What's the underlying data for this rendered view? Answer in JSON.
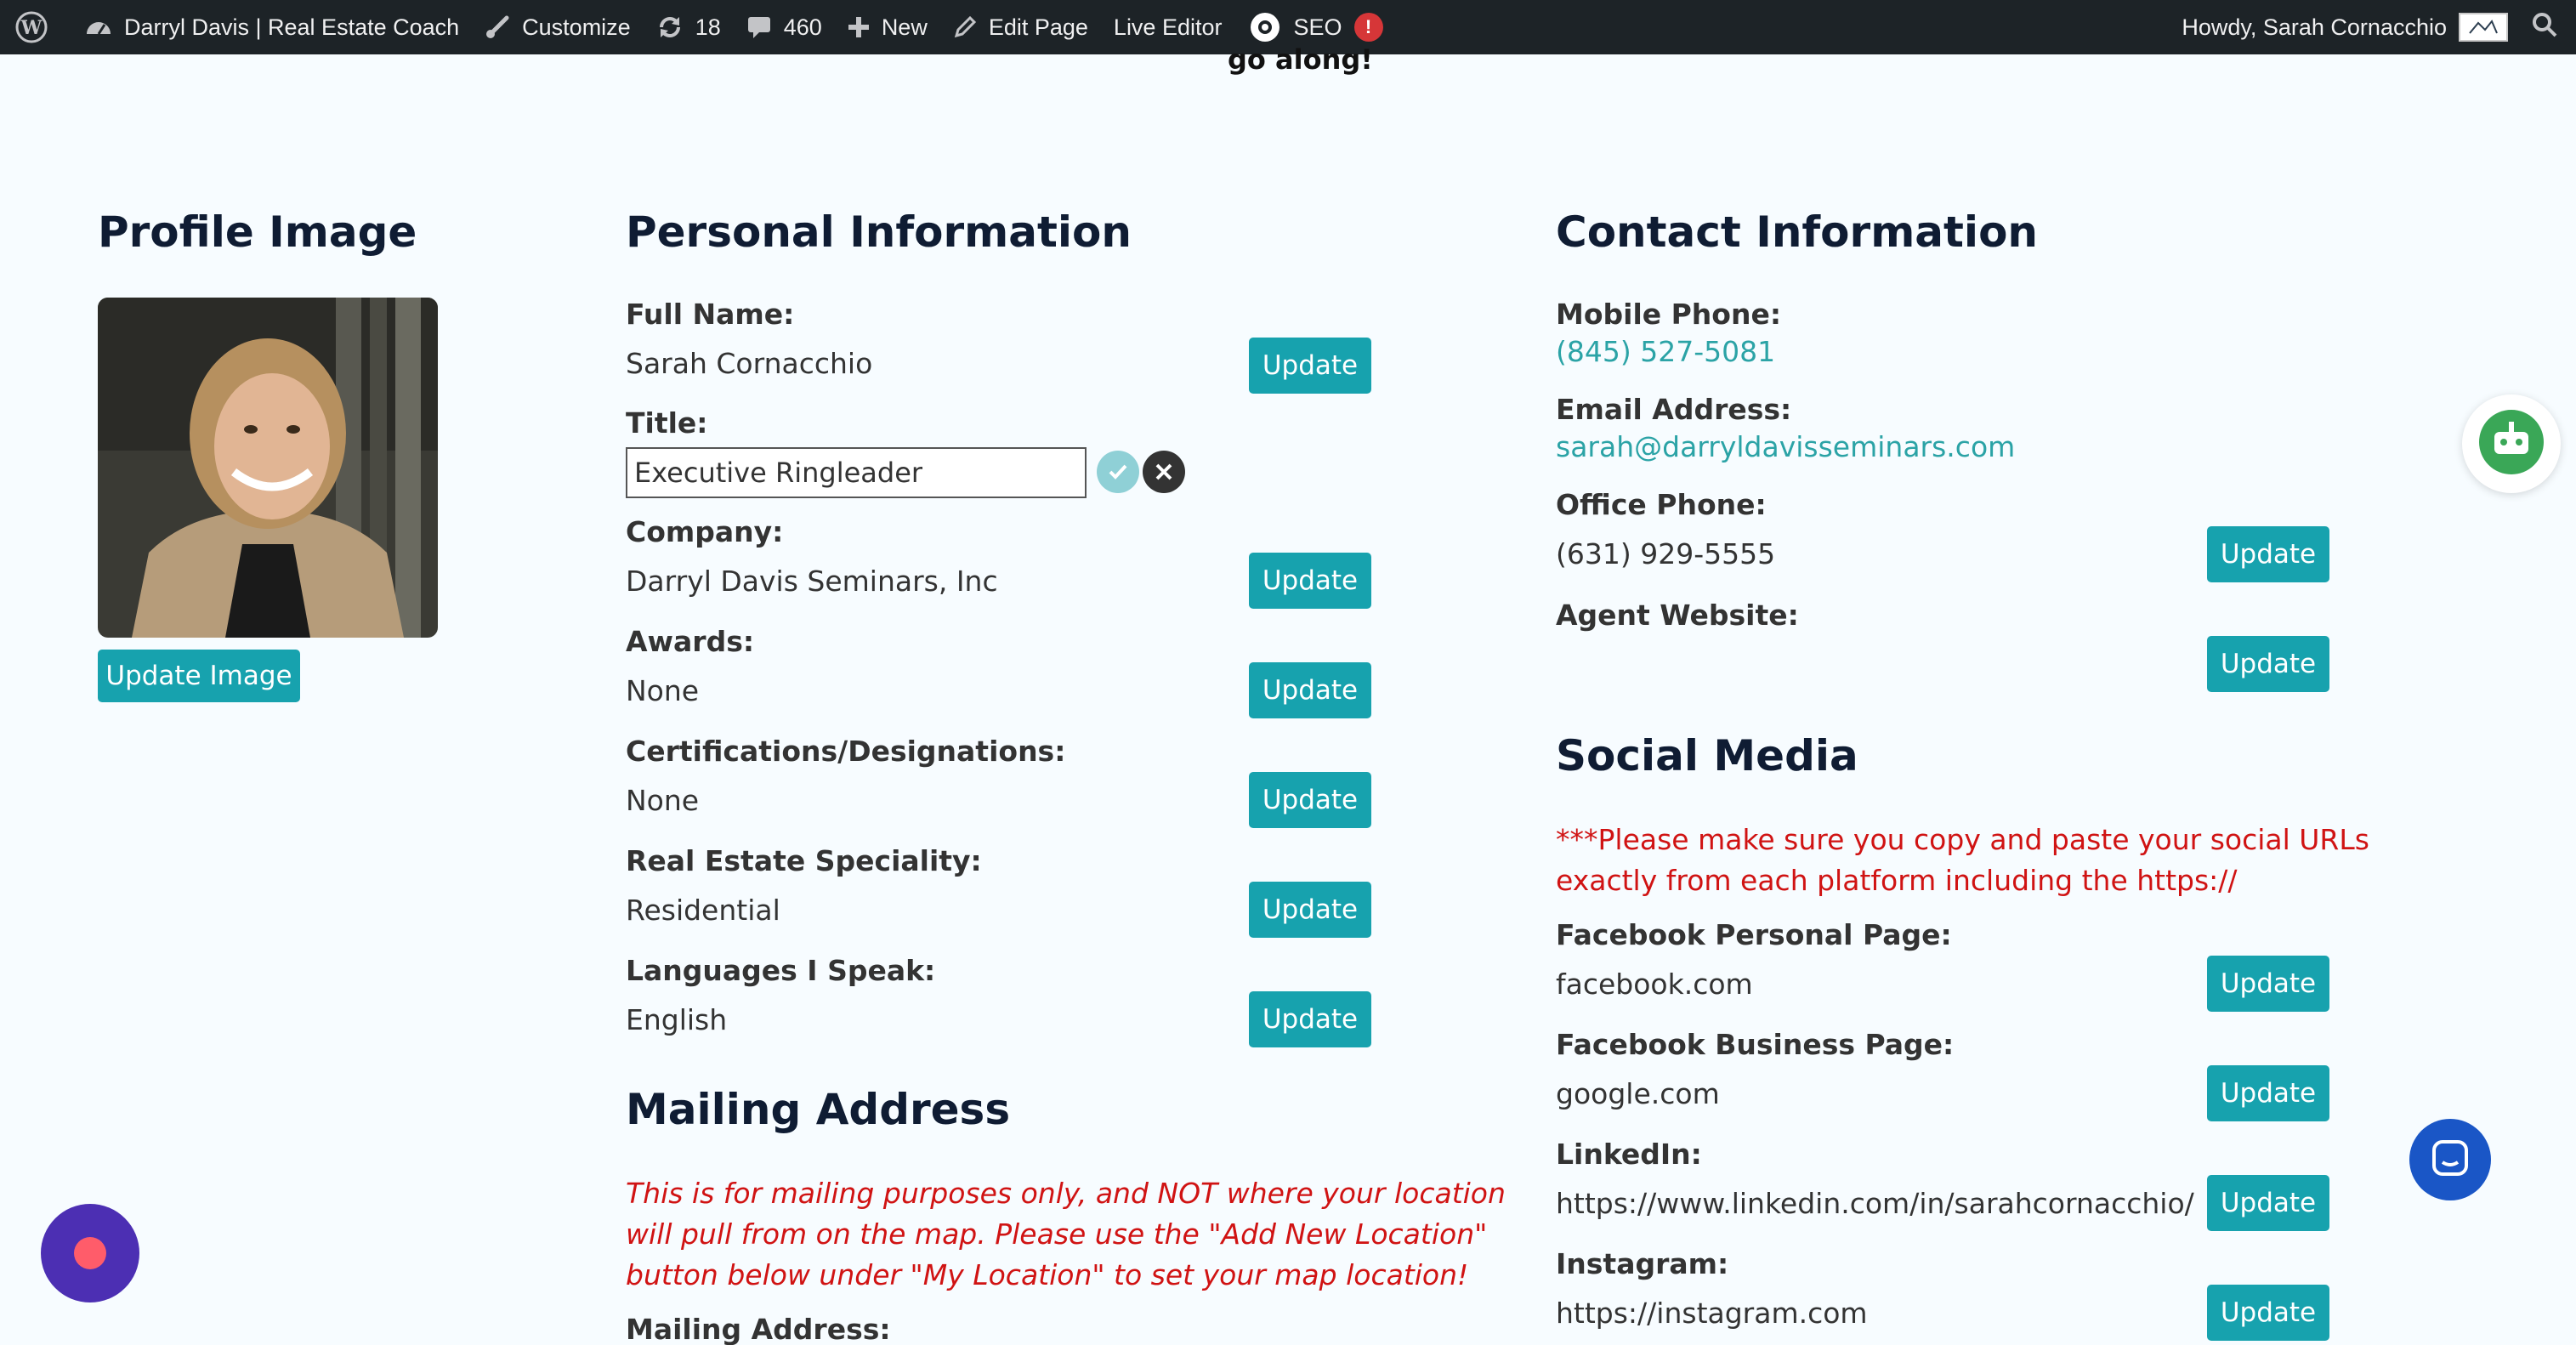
{
  "adminbar": {
    "site_name": "Darryl Davis | Real Estate Coach",
    "customize": "Customize",
    "updates_count": "18",
    "comments_count": "460",
    "new": "New",
    "edit_page": "Edit Page",
    "live_editor": "Live Editor",
    "seo": "SEO",
    "seo_alert": "!",
    "howdy": "Howdy, Sarah Cornacchio"
  },
  "partial_heading": "go along!",
  "profile": {
    "heading": "Profile Image",
    "update_image": "Update Image"
  },
  "personal": {
    "heading": "Personal Information",
    "update_label": "Update",
    "fields": {
      "full_name": {
        "label": "Full Name:",
        "value": "Sarah Cornacchio"
      },
      "title": {
        "label": "Title:",
        "value": "Executive Ringleader"
      },
      "company": {
        "label": "Company:",
        "value": "Darryl Davis Seminars, Inc"
      },
      "awards": {
        "label": "Awards:",
        "value": "None"
      },
      "certifications": {
        "label": "Certifications/Designations:",
        "value": "None"
      },
      "speciality": {
        "label": "Real Estate Speciality:",
        "value": "Residential"
      },
      "languages": {
        "label": "Languages I Speak:",
        "value": "English"
      }
    }
  },
  "mailing": {
    "heading": "Mailing Address",
    "notice": "This is for mailing purposes only, and NOT where your location will pull from on the map. Please use the \"Add New Location\" button below under \"My Location\" to set your map location!",
    "label": "Mailing Address:"
  },
  "contact": {
    "heading": "Contact Information",
    "mobile": {
      "label": "Mobile Phone:",
      "value": "(845) 527-5081"
    },
    "email": {
      "label": "Email Address:",
      "value": "sarah@darryldavisseminars.com"
    },
    "office": {
      "label": "Office Phone:",
      "value": "(631) 929-5555"
    },
    "website": {
      "label": "Agent Website:",
      "value": ""
    }
  },
  "social": {
    "heading": "Social Media",
    "notice": "***Please make sure you copy and paste your social URLs exactly from each platform including the https://",
    "facebook_personal": {
      "label": "Facebook Personal Page:",
      "value": "facebook.com"
    },
    "facebook_business": {
      "label": "Facebook Business Page:",
      "value": "google.com"
    },
    "linkedin": {
      "label": "LinkedIn:",
      "value": "https://www.linkedin.com/in/sarahcornacchio/"
    },
    "instagram": {
      "label": "Instagram:",
      "value": "https://instagram.com"
    }
  },
  "colors": {
    "accent": "#17a2ae",
    "link": "#2ba3a6",
    "heading": "#0f1c33",
    "warning": "#d01313",
    "adminbar": "#1d2327"
  }
}
